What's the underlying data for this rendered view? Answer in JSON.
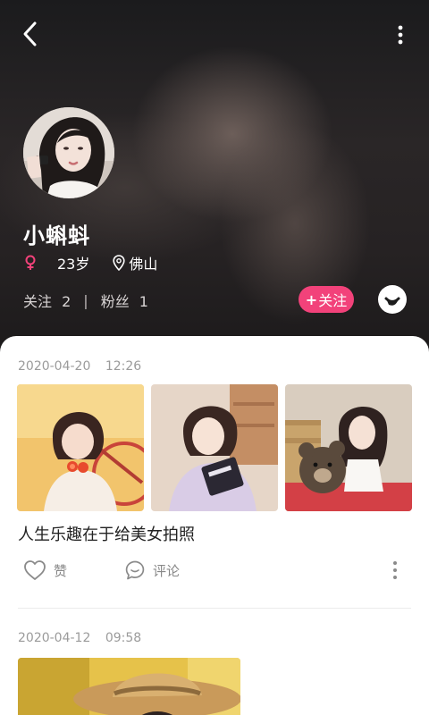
{
  "profile": {
    "name": "小蝌蚪",
    "age": "23岁",
    "location": "佛山",
    "following_label": "关注",
    "following_count": "2",
    "separator": "|",
    "fans_label": "粉丝",
    "fans_count": "1",
    "follow_button_plus": "+",
    "follow_button_label": "关注"
  },
  "icons": {
    "back": "back-arrow-icon",
    "more": "more-vertical-icon",
    "gender": "female-icon",
    "location": "location-pin-icon",
    "chat": "chat-icon",
    "like": "heart-icon",
    "comment": "comment-icon"
  },
  "colors": {
    "accent": "#f2427a",
    "female": "#f2427a"
  },
  "posts": [
    {
      "date": "2020-04-20",
      "time": "12:26",
      "text": "人生乐趣在于给美女拍照",
      "like_label": "赞",
      "comment_label": "评论"
    },
    {
      "date": "2020-04-12",
      "time": "09:58"
    }
  ]
}
